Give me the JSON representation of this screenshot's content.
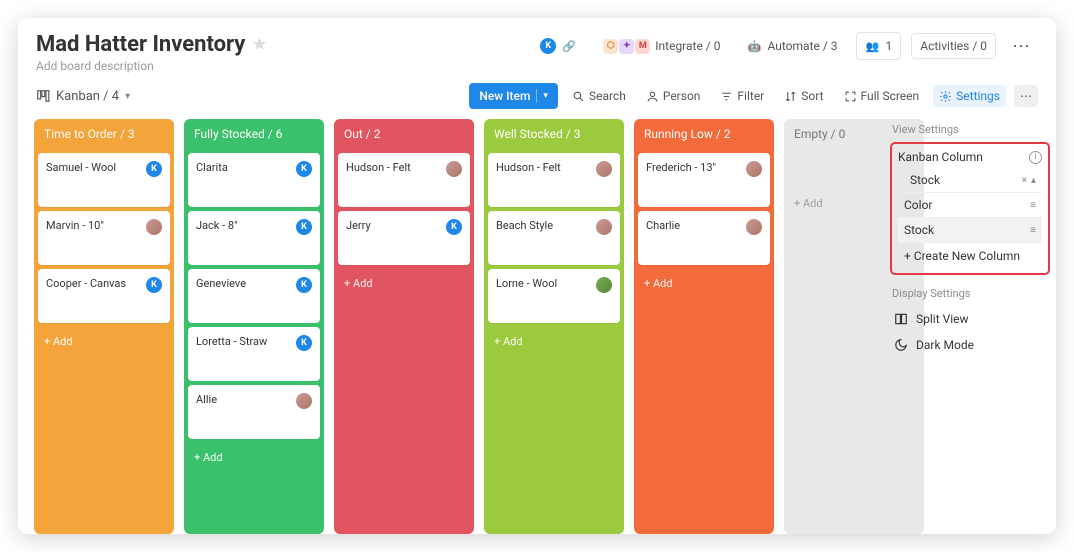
{
  "title": "Mad Hatter Inventory",
  "subtitle": "Add board description",
  "header": {
    "integrate_label": "Integrate / 0",
    "automate_label": "Automate / 3",
    "members_label": "1",
    "activities_label": "Activities / 0"
  },
  "tabs": {
    "view_label": "Kanban / 4"
  },
  "toolbar": {
    "new_item_label": "New Item",
    "search_label": "Search",
    "person_label": "Person",
    "filter_label": "Filter",
    "sort_label": "Sort",
    "fullscreen_label": "Full Screen",
    "settings_label": "Settings"
  },
  "columns": [
    {
      "id": "timeToOrder",
      "header": "Time to Order / 3",
      "add": "+ Add",
      "cards": [
        {
          "label": "Samuel - Wool",
          "avatar": "k"
        },
        {
          "label": "Marvin - 10\"",
          "avatar": "f"
        },
        {
          "label": "Cooper - Canvas",
          "avatar": "k"
        }
      ]
    },
    {
      "id": "fullyStocked",
      "header": "Fully Stocked / 6",
      "add": "+ Add",
      "cards": [
        {
          "label": "Clarita",
          "avatar": "k"
        },
        {
          "label": "Jack - 8\"",
          "avatar": "k"
        },
        {
          "label": "Genevieve",
          "avatar": "k"
        },
        {
          "label": "Loretta - Straw",
          "avatar": "k"
        },
        {
          "label": "Allie",
          "avatar": "f"
        }
      ]
    },
    {
      "id": "out",
      "header": "Out / 2",
      "add": "+ Add",
      "cards": [
        {
          "label": "Hudson - Felt",
          "avatar": "f"
        },
        {
          "label": "Jerry",
          "avatar": "k"
        }
      ]
    },
    {
      "id": "wellStocked",
      "header": "Well Stocked / 3",
      "add": "+ Add",
      "cards": [
        {
          "label": "Hudson - Felt",
          "avatar": "f"
        },
        {
          "label": "Beach Style",
          "avatar": "f"
        },
        {
          "label": "Lorne - Wool",
          "avatar": "m"
        }
      ]
    },
    {
      "id": "runningLow",
      "header": "Running Low / 2",
      "add": "+ Add",
      "cards": [
        {
          "label": "Frederich - 13\"",
          "avatar": "f"
        },
        {
          "label": "Charlie",
          "avatar": "f"
        }
      ]
    },
    {
      "id": "empty",
      "header": "Empty / 0",
      "add": "+ Add",
      "cards": [],
      "empty": true
    }
  ],
  "side": {
    "view_settings_label": "View Settings",
    "kanban_column_label": "Kanban Column",
    "selected": "Stock",
    "options": [
      {
        "label": "Color"
      },
      {
        "label": "Stock",
        "selected": true
      }
    ],
    "create_label": "+ Create New Column",
    "display_settings_label": "Display Settings",
    "split_view_label": "Split View",
    "dark_mode_label": "Dark Mode"
  }
}
